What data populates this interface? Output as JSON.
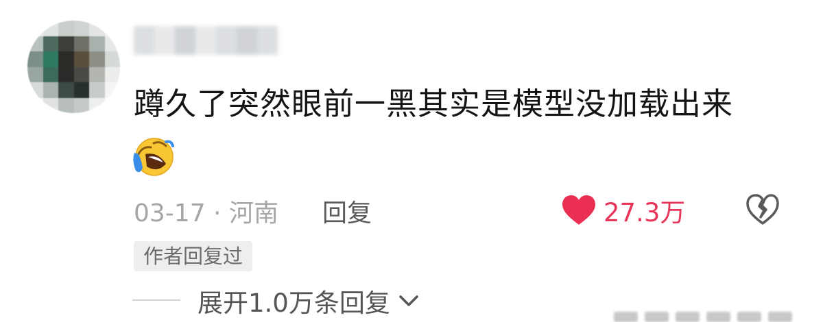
{
  "comment": {
    "text": "蹲久了突然眼前一黑其实是模型没加载出来",
    "emoji": "laughing-tears-emoji",
    "date_location": "03-17 · 河南",
    "reply_label": "回复",
    "like_count": "27.3万",
    "author_tag": "作者回复过",
    "expand_replies": "展开1.0万条回复"
  },
  "icons": {
    "like": "heart-icon",
    "dislike": "broken-heart-icon",
    "expand": "chevron-down-icon"
  },
  "colors": {
    "like": "#e8355a",
    "text": "#141414",
    "meta": "#a6a6a6"
  }
}
